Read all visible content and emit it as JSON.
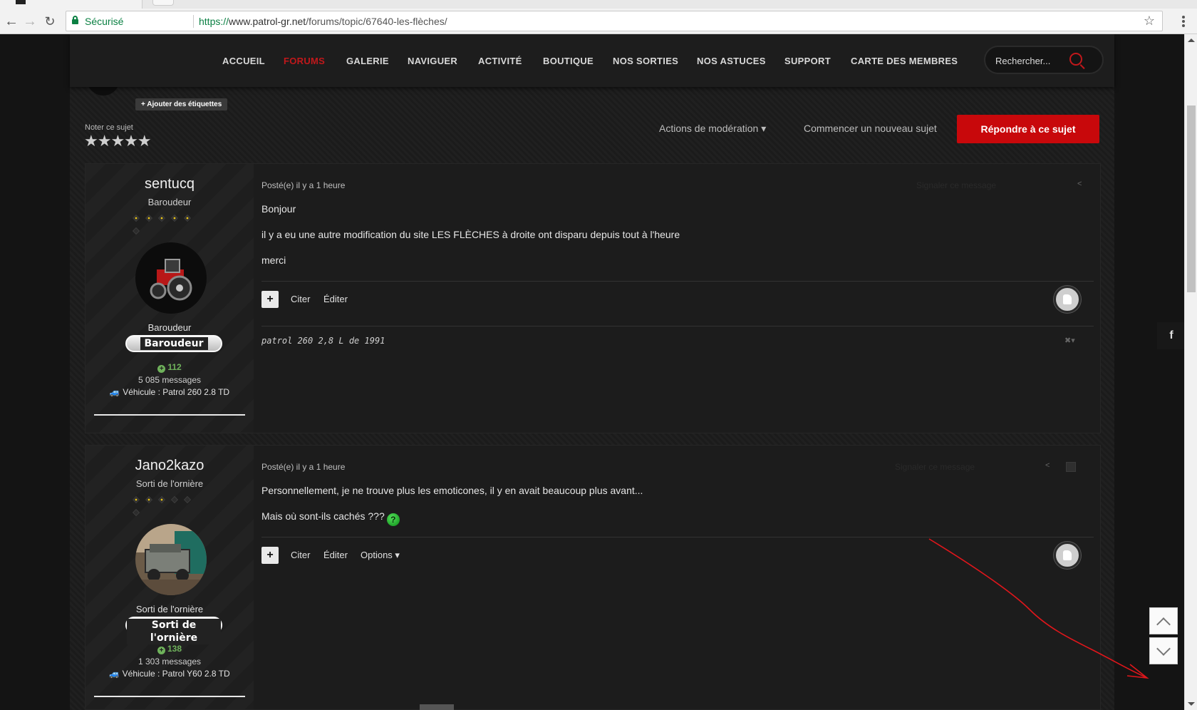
{
  "browser": {
    "secure_label": "Sécurisé",
    "url_proto": "https://",
    "url_host": "www.patrol-gr.net",
    "url_path": "/forums/topic/67640-les-flèches/"
  },
  "nav": {
    "items": [
      "ACCUEIL",
      "FORUMS",
      "GALERIE",
      "NAVIGUER",
      "ACTIVITÉ",
      "BOUTIQUE",
      "NOS SORTIES",
      "NOS ASTUCES",
      "SUPPORT",
      "CARTE DES MEMBRES"
    ],
    "active": "FORUMS",
    "search_placeholder": "Rechercher..."
  },
  "topic": {
    "add_tags": "+ Ajouter des étiquettes",
    "rate_label": "Noter ce sujet",
    "stars": "★★★★★",
    "mod_actions": "Actions de modération ▾",
    "new_topic": "Commencer un nouveau sujet",
    "reply": "Répondre à ce sujet"
  },
  "posts": [
    {
      "author": "sentucq",
      "rank": "Baroudeur",
      "rank_label": "Baroudeur",
      "badge": "Baroudeur",
      "reputation": "112",
      "messages": "5 085 messages",
      "vehicle": "Véhicule : Patrol 260 2.8 TD",
      "posted": "Posté(e) il y a 1 heure",
      "body": [
        "Bonjour",
        "il y a eu une autre modification du site LES FLÈCHES à droite ont disparu depuis tout à l'heure",
        "merci"
      ],
      "report": "Signaler ce message",
      "actions": [
        "Citer",
        "Éditer"
      ],
      "signature": "patrol 260 2,8 L de 1991"
    },
    {
      "author": "Jano2kazo",
      "rank": "Sorti de l'ornière",
      "rank_label": "Sorti de l'ornière",
      "badge": "Sorti de l'ornière",
      "reputation": "138",
      "messages": "1 303 messages",
      "vehicle": "Véhicule : Patrol Y60 2.8 TD",
      "posted": "Posté(e) il y a 1 heure",
      "body": [
        "Personnellement, je ne trouve plus les emoticones, il y en avait beaucoup plus avant...",
        "Mais où sont-ils cachés ???"
      ],
      "report": "Signaler ce message",
      "actions": [
        "Citer",
        "Éditer",
        "Options ▾"
      ]
    }
  ],
  "colors": {
    "accent": "#c8080b",
    "active_nav": "#c1181b",
    "rep_green": "#6fb25b",
    "annotation": "#e0161b"
  }
}
